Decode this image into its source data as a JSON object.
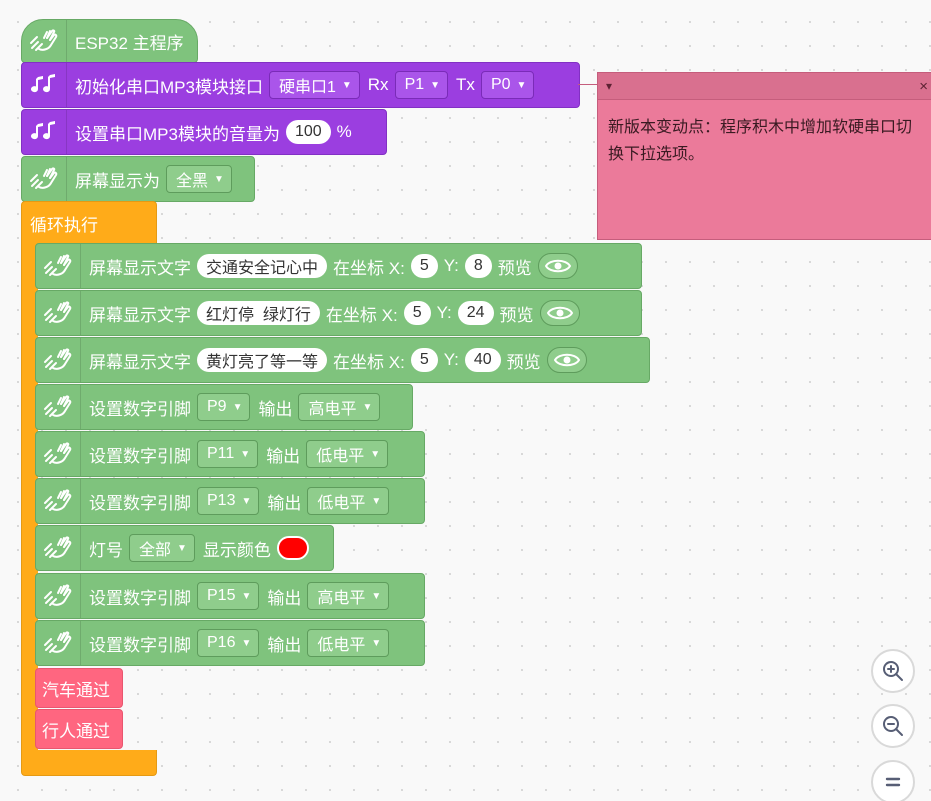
{
  "main_program": {
    "label": "ESP32 主程序"
  },
  "mp3_init": {
    "label": "初始化串口MP3模块接口",
    "port": "硬串口1",
    "rx_label": "Rx",
    "rx_pin": "P1",
    "tx_label": "Tx",
    "tx_pin": "P0"
  },
  "mp3_volume": {
    "label": "设置串口MP3模块的音量为",
    "value": "100",
    "unit": "%"
  },
  "screen_fill": {
    "label": "屏幕显示为",
    "option": "全黑"
  },
  "loop": {
    "label": "循环执行"
  },
  "screen_text": [
    {
      "label": "屏幕显示文字",
      "text": "交通安全记心中",
      "coord_label": "在坐标 X:",
      "x": "5",
      "y_label": "Y:",
      "y": "8",
      "preview_label": "预览"
    },
    {
      "label": "屏幕显示文字",
      "text": "红灯停  绿灯行",
      "coord_label": "在坐标 X:",
      "x": "5",
      "y_label": "Y:",
      "y": "24",
      "preview_label": "预览"
    },
    {
      "label": "屏幕显示文字",
      "text": "黄灯亮了等一等",
      "coord_label": "在坐标 X:",
      "x": "5",
      "y_label": "Y:",
      "y": "40",
      "preview_label": "预览"
    }
  ],
  "digital_pins": [
    {
      "label": "设置数字引脚",
      "pin": "P9",
      "output_label": "输出",
      "level": "高电平"
    },
    {
      "label": "设置数字引脚",
      "pin": "P11",
      "output_label": "输出",
      "level": "低电平"
    },
    {
      "label": "设置数字引脚",
      "pin": "P13",
      "output_label": "输出",
      "level": "低电平"
    },
    {
      "label": "设置数字引脚",
      "pin": "P15",
      "output_label": "输出",
      "level": "高电平"
    },
    {
      "label": "设置数字引脚",
      "pin": "P16",
      "output_label": "输出",
      "level": "低电平"
    }
  ],
  "led": {
    "label": "灯号",
    "option": "全部",
    "color_label": "显示颜色",
    "color": "#ff0000"
  },
  "procedures": [
    {
      "label": "汽车通过"
    },
    {
      "label": "行人通过"
    }
  ],
  "comment": {
    "text": "新版本变动点：程序积木中增加软硬串口切换下拉选项。",
    "close_glyph": "×",
    "collapse_glyph": "▾"
  },
  "colors": {
    "green": "#7fc37d",
    "purple": "#9b3ee0",
    "orange": "#ffab19",
    "pink": "#ff6680",
    "comment": "#eb7a9a"
  },
  "icons": {
    "hand_icon": "hand-icon",
    "music_icon": "music-note-icon",
    "eye_icon": "eye-icon",
    "zoom_in": "zoom-in-icon",
    "zoom_out": "zoom-out-icon",
    "reset": "reset-zoom-icon"
  }
}
